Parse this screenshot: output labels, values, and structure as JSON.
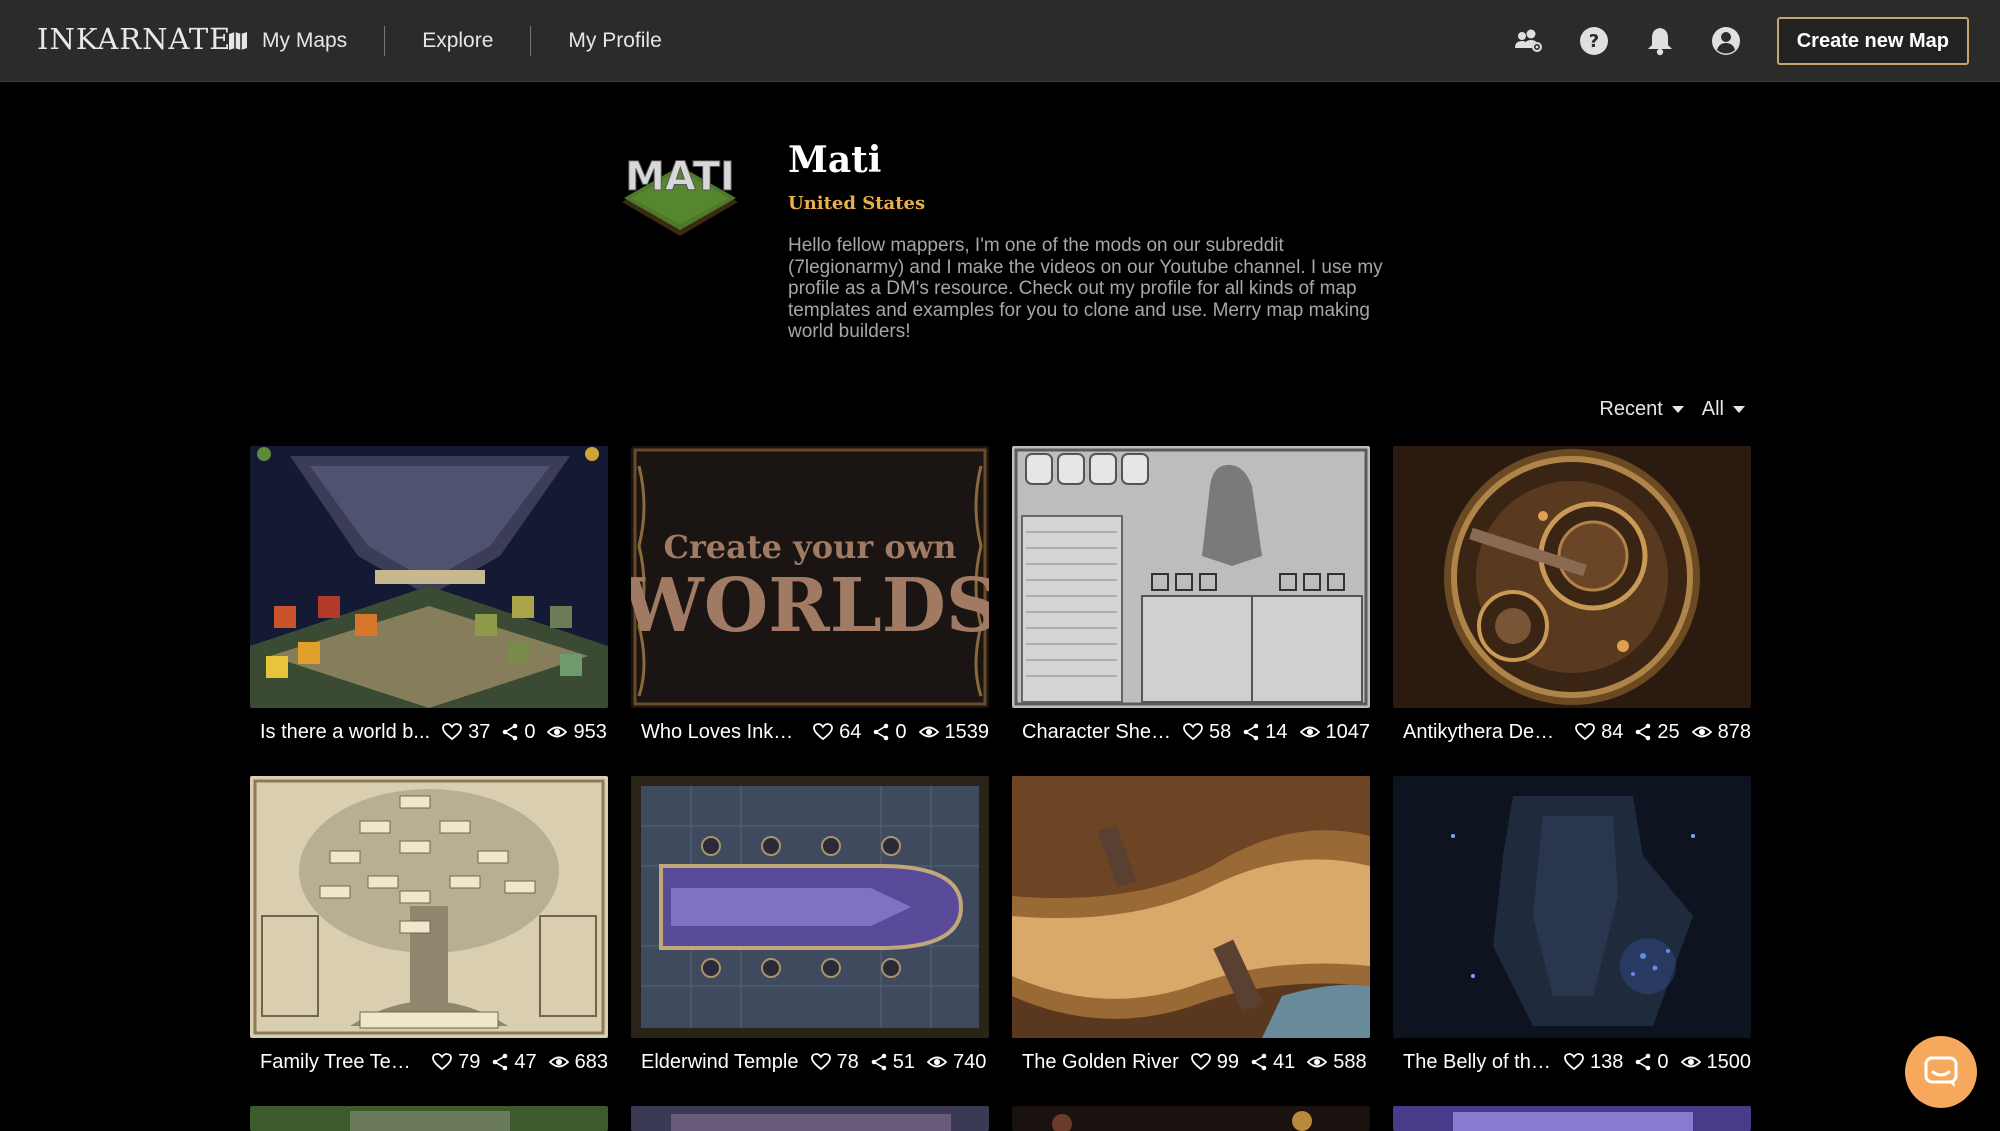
{
  "app": {
    "logo": "INKARNATE",
    "nav": {
      "my_maps": "My Maps",
      "explore": "Explore",
      "my_profile": "My Profile"
    },
    "create_button": "Create new Map"
  },
  "profile": {
    "avatar_text": "MATI",
    "name": "Mati",
    "country": "United States",
    "bio": "Hello fellow mappers, I'm one of the mods on our subreddit (7legionarmy) and I make the videos on our Youtube channel. I use my profile as a DM's resource. Check out my profile for all kinds of map templates and examples for you to clone and use. Merry map making world builders!"
  },
  "filters": {
    "sort": "Recent",
    "type": "All"
  },
  "maps": [
    {
      "title": "Is there a world b...",
      "likes": "37",
      "shares": "0",
      "views": "953"
    },
    {
      "title": "Who Loves Inkar...",
      "likes": "64",
      "shares": "0",
      "views": "1539",
      "thumb_text_1": "Create your own",
      "thumb_text_2": "WORLDS"
    },
    {
      "title": "Character Shee...",
      "likes": "58",
      "shares": "14",
      "views": "1047"
    },
    {
      "title": "Antikythera Devi...",
      "likes": "84",
      "shares": "25",
      "views": "878"
    },
    {
      "title": "Family Tree Tem...",
      "likes": "79",
      "shares": "47",
      "views": "683"
    },
    {
      "title": "Elderwind Temple",
      "likes": "78",
      "shares": "51",
      "views": "740"
    },
    {
      "title": "The Golden River",
      "likes": "99",
      "shares": "41",
      "views": "588"
    },
    {
      "title": "The Belly of the...",
      "likes": "138",
      "shares": "0",
      "views": "1500"
    }
  ],
  "colors": {
    "accent_gold": "#c9a56e",
    "country_color": "#e9b04a",
    "chat_button": "#f6a85d"
  }
}
